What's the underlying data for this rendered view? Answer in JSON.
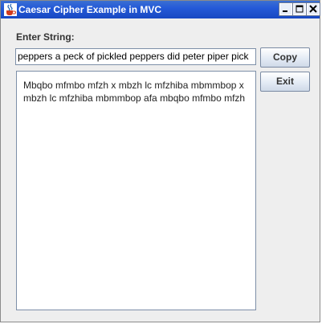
{
  "window": {
    "title": "Caesar Cipher Example in MVC"
  },
  "form": {
    "label": "Enter String:",
    "input_value": "peppers a peck of pickled peppers did peter piper pick",
    "output_text": "Mbqbo mfmbo mfzh x mbzh lc mfzhiba mbmmbop x mbzh lc mfzhiba mbmmbop afa mbqbo mfmbo mfzh"
  },
  "buttons": {
    "copy": "Copy",
    "exit": "Exit"
  },
  "icons": {
    "app": "java-cup-icon",
    "minimize": "minimize-icon",
    "maximize": "maximize-icon",
    "close": "close-icon"
  },
  "colors": {
    "titlebar": "#245ad8",
    "window_bg": "#eeeeee"
  }
}
